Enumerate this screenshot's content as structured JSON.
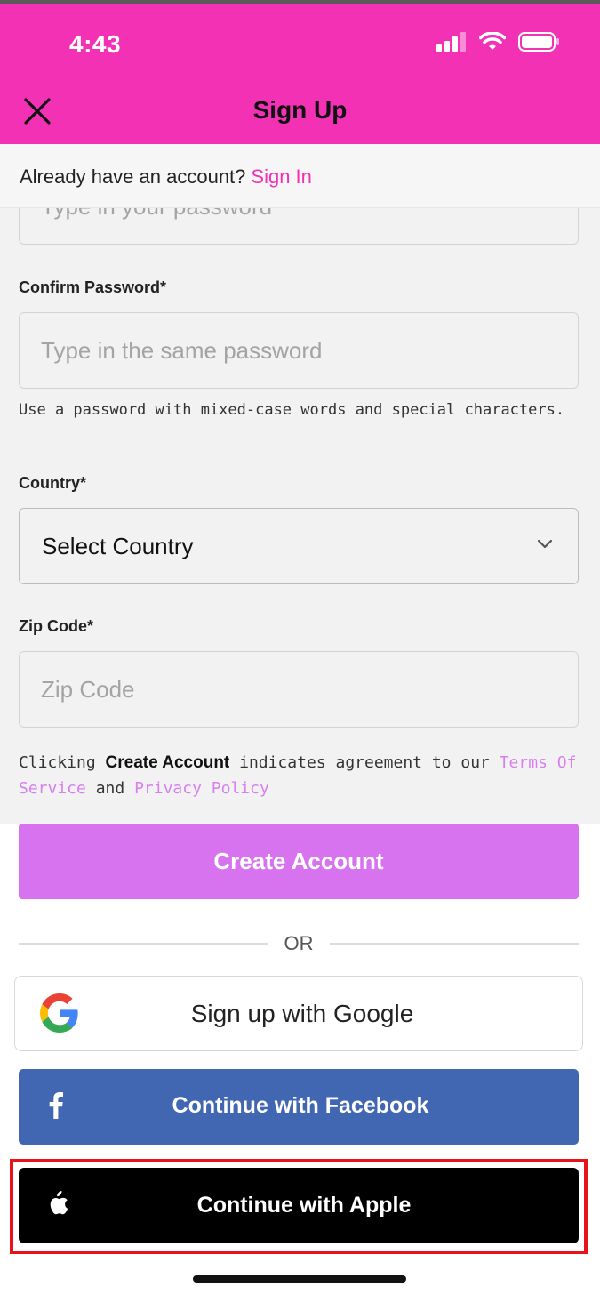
{
  "status_bar": {
    "time": "4:43"
  },
  "header": {
    "title": "Sign Up"
  },
  "signin": {
    "prompt": "Already have an account?",
    "link": "Sign In"
  },
  "form": {
    "password": {
      "placeholder": "Type in your password"
    },
    "confirm_password": {
      "label": "Confirm Password*",
      "placeholder": "Type in the same password"
    },
    "password_hint": "Use a password with mixed-case words and special characters.",
    "country": {
      "label": "Country*",
      "value": "Select Country"
    },
    "zip": {
      "label": "Zip Code*",
      "placeholder": "Zip Code"
    },
    "legal": {
      "prefix": "Clicking",
      "action": "Create Account",
      "middle": "indicates agreement to our",
      "terms": "Terms Of Service",
      "and": "and",
      "privacy": "Privacy Policy"
    }
  },
  "actions": {
    "create_account": "Create Account",
    "or": "OR",
    "google": "Sign up with Google",
    "facebook": "Continue with Facebook",
    "apple": "Continue with Apple"
  },
  "colors": {
    "brand_pink": "#f231b5",
    "create_button": "#d873ef",
    "facebook_blue": "#4267b2",
    "highlight_red": "#e8121a"
  },
  "icons": [
    "signal-icon",
    "wifi-icon",
    "battery-icon",
    "close-icon",
    "chevron-down-icon",
    "google-icon",
    "facebook-icon",
    "apple-icon"
  ]
}
